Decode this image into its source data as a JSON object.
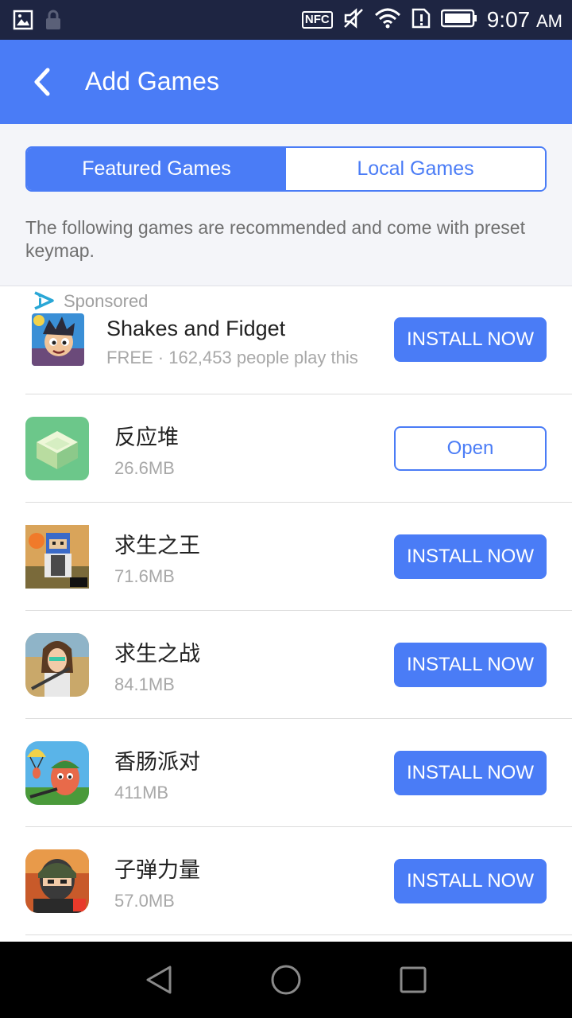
{
  "status_bar": {
    "time": "9:07",
    "ampm": "AM",
    "nfc_label": "NFC"
  },
  "app_bar": {
    "title": "Add Games"
  },
  "tabs": [
    {
      "label": "Featured Games",
      "active": true
    },
    {
      "label": "Local Games",
      "active": false
    }
  ],
  "description": "The following games are recommended and come with preset keymap.",
  "sponsored": {
    "label": "Sponsored",
    "name": "Shakes and Fidget",
    "subtitle": "FREE · 162,453 people play this",
    "button": "INSTALL NOW"
  },
  "games": [
    {
      "name": "反应堆",
      "size": "26.6MB",
      "button": "Open"
    },
    {
      "name": "求生之王",
      "size": "71.6MB",
      "button": "INSTALL NOW"
    },
    {
      "name": "求生之战",
      "size": "84.1MB",
      "button": "INSTALL NOW"
    },
    {
      "name": "香肠派对",
      "size": "411MB",
      "button": "INSTALL NOW"
    },
    {
      "name": "子弹力量",
      "size": "57.0MB",
      "button": "INSTALL NOW"
    }
  ],
  "colors": {
    "accent": "#4a7cf6",
    "status_bar": "#1e2542",
    "nav_bar": "#000000"
  }
}
